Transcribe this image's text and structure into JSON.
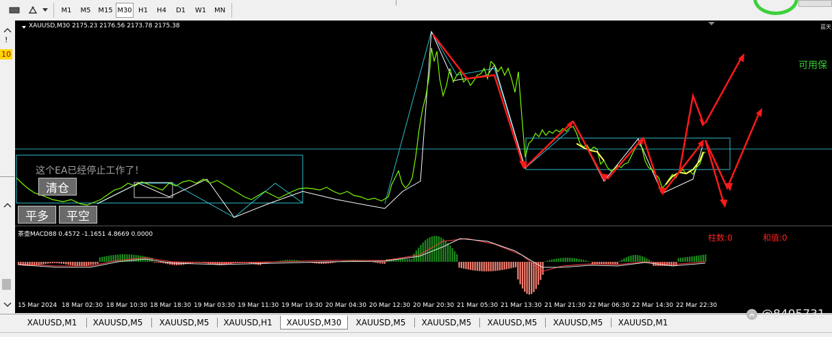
{
  "toolbar": {
    "timeframes": [
      "M1",
      "M5",
      "M15",
      "M30",
      "H1",
      "H4",
      "D1",
      "W1",
      "MN"
    ],
    "active_timeframe": "M30",
    "chart_type_icon": "chart-type-icon",
    "drawing_tools_icon": "drawing-tools-icon",
    "dropdown_icon": "chevron-down-icon"
  },
  "left_strip": {
    "labels": [
      "!",
      "10"
    ],
    "scroll_up_icon": "scroll-up-icon",
    "scroll_down_icon": "scroll-down-icon"
  },
  "main_chart": {
    "header": "XAUUSD,M30  2175.23 2176.56 2173.78 2175.38",
    "corner_label": "蓝天",
    "available_margin_label": "可用保",
    "ea_notice": "这个EA已经停止工作了！",
    "buttons": {
      "close_all": "清仓",
      "flat_long": "平多",
      "flat_short": "平空"
    }
  },
  "indicator": {
    "header": "茶壶MACD88 0.4572 -1.1651 4.8669 0.0000",
    "bar_count_label": "柱数:0",
    "sum_label": "和值:0"
  },
  "x_axis": {
    "labels": [
      "15 Mar 2024",
      "18 Mar 02:30",
      "18 Mar 10:30",
      "18 Mar 18:30",
      "19 Mar 03:30",
      "19 Mar 11:30",
      "19 Mar 19:30",
      "20 Mar 04:30",
      "20 Mar 12:30",
      "20 Mar 20:30",
      "21 Mar 05:30",
      "21 Mar 13:30",
      "21 Mar 21:30",
      "22 Mar 06:30",
      "22 Mar 14:30",
      "22 Mar 22:30"
    ]
  },
  "tabs": {
    "items": [
      "XAUUSD,M1",
      "XAUUSD,M5",
      "XAUUSD,M5",
      "XAUUSD,H1",
      "XAUUSD,M30",
      "XAUUSD,M5",
      "XAUUSD,M5",
      "XAUUSD,M5",
      "XAUUSD,M5",
      "XAUUSD,M1"
    ],
    "active_index": 4
  },
  "watermark": {
    "text": "@8405731",
    "icon": "social-logo-icon"
  },
  "colors": {
    "chart_background": "#000000",
    "price_line": "#7cfc00",
    "zigzag": "#ffffff",
    "channel": "#00ced1",
    "arrows": "#ff1a1a",
    "macd_positive": "#1e8c1e",
    "macd_negative": "#fa8072",
    "notice_text": "#a0a0a0",
    "labels_red": "#ff2020",
    "labels_green": "#32cd32"
  }
}
